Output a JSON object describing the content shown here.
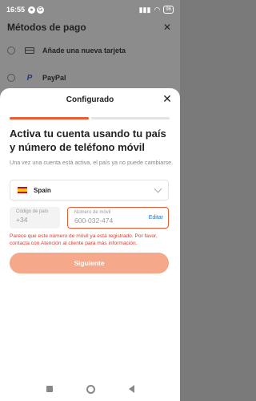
{
  "status_bar": {
    "time": "16:55",
    "battery": "96"
  },
  "background_page": {
    "title": "Métodos de pago",
    "options": [
      {
        "label": "Añade una nueva tarjeta",
        "icon": "credit-card-icon"
      },
      {
        "label": "PayPal",
        "icon": "paypal-icon"
      }
    ]
  },
  "sheet": {
    "title": "Configurado",
    "progress_steps": [
      true,
      false
    ],
    "headline": "Activa tu cuenta usando tu país y número de teléfono móvil",
    "subtitle": "Una vez una cuenta está activa, el país ya no puede cambiarse.",
    "country": {
      "name": "Spain",
      "flag": "spain-flag-icon"
    },
    "country_code": {
      "label": "Código de país",
      "value": "+34"
    },
    "phone": {
      "label": "Número de móvil",
      "value": "600-032-474",
      "edit_label": "Editar"
    },
    "error_message": "Parece que este número de móvil ya está registrado. Por favor, contacta con Atención al cliente para más información.",
    "submit_label": "Siguiente"
  },
  "colors": {
    "accent": "#ee5a32",
    "button_disabled": "#f6a88a",
    "error": "#e0392b",
    "link": "#1a73e8"
  }
}
